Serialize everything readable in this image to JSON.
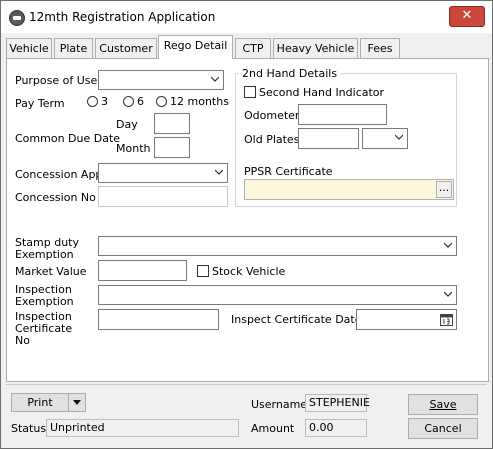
{
  "window": {
    "title": "12mth Registration Application",
    "close_glyph": "✕"
  },
  "tabs": [
    {
      "label": "Vehicle"
    },
    {
      "label": "Plate"
    },
    {
      "label": "Customer"
    },
    {
      "label": "Rego Detail"
    },
    {
      "label": "CTP"
    },
    {
      "label": "Heavy Vehicle"
    },
    {
      "label": "Fees"
    }
  ],
  "active_tab": "Rego Detail",
  "form": {
    "purpose_label": "Purpose of Use",
    "pay_term_label": "Pay Term",
    "pay_term_options": [
      "3",
      "6",
      "12 months"
    ],
    "due_date_label": "Common Due Date",
    "day_label": "Day",
    "month_label": "Month",
    "concession_app_label": "Concession App",
    "concession_no_label": "Concession No",
    "stamp_duty_label": "Stamp duty Exemption",
    "market_value_label": "Market Value",
    "stock_vehicle_label": "Stock Vehicle",
    "inspection_exemption_label": "Inspection Exemption",
    "inspection_cert_label": "Inspection Certificate No",
    "inspect_cert_date_label": "Inspect Certificate Date"
  },
  "second_hand": {
    "group_label": "2nd Hand Details",
    "indicator_label": "Second Hand Indicator",
    "odometer_label": "Odometer",
    "old_plates_label": "Old Plates",
    "ppsr_label": "PPSR Certificate",
    "ppsr_button": "..."
  },
  "footer": {
    "print_label": "Print",
    "status_label": "Status",
    "status_value": "Unprinted",
    "username_label": "Username",
    "username_value": "STEPHENIE",
    "amount_label": "Amount",
    "amount_value": "0.00",
    "save_label": "Save",
    "cancel_label": "Cancel"
  },
  "colors": {
    "ppsr_field_bg": "#fdf8dc",
    "close_button": "#c9483b"
  }
}
